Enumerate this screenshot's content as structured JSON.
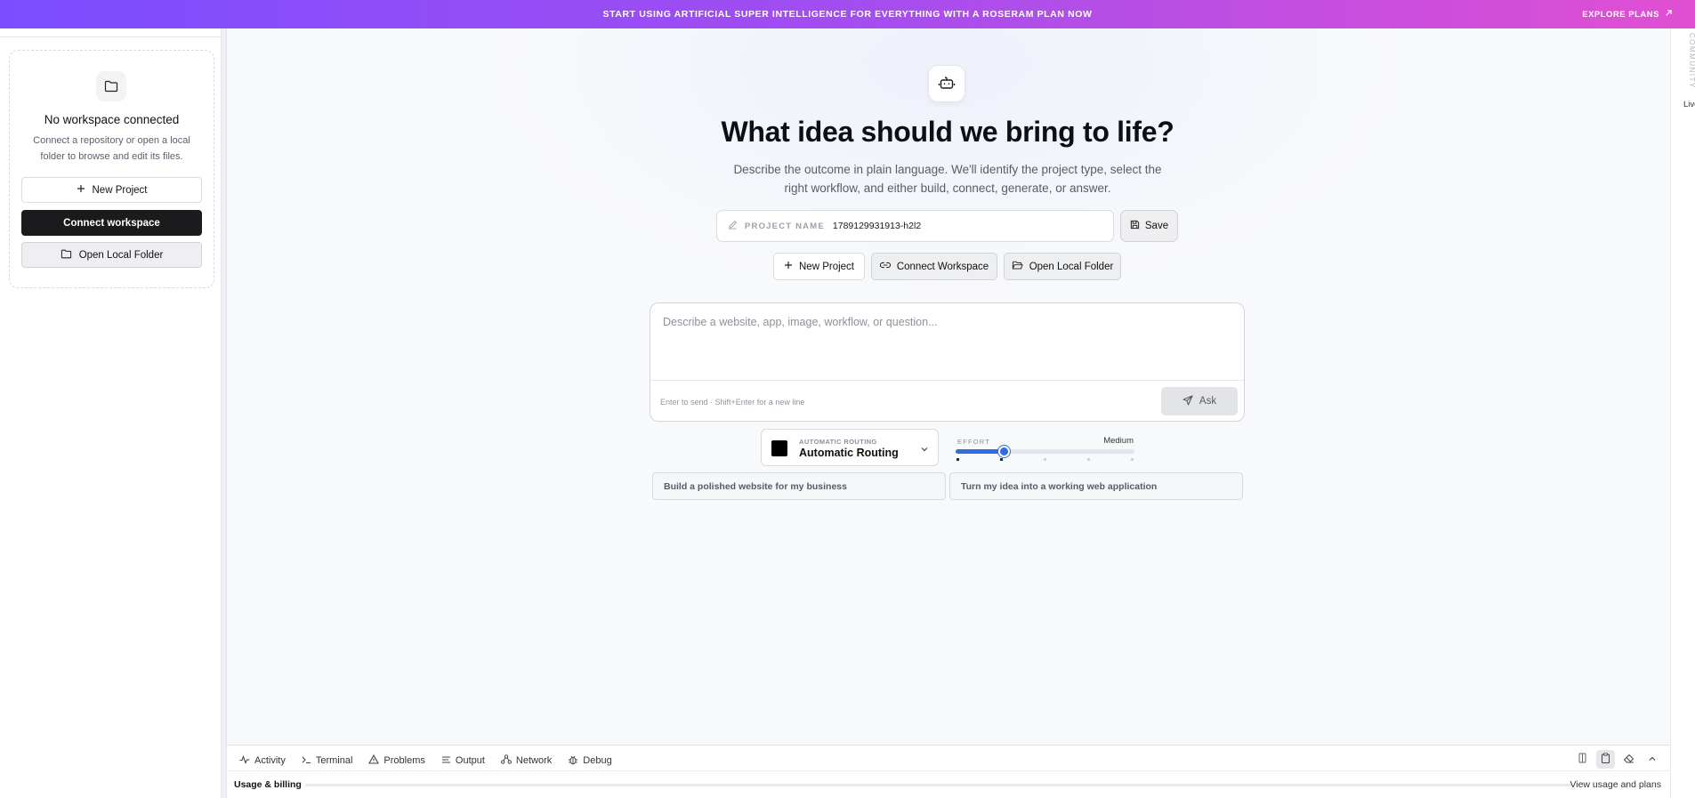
{
  "banner": {
    "message": "START USING ARTIFICIAL SUPER INTELLIGENCE FOR EVERYTHING WITH A ROSERAM PLAN NOW",
    "cta": "EXPLORE PLANS"
  },
  "sidebar": {
    "title": "No workspace connected",
    "description": "Connect a repository or open a local folder to browse and edit its files.",
    "new_project": "New Project",
    "connect_workspace": "Connect workspace",
    "open_local_folder": "Open Local Folder"
  },
  "main": {
    "title": "What idea should we bring to life?",
    "subtitle": "Describe the outcome in plain language. We'll identify the project type, select the right workflow, and either build, connect, generate, or answer.",
    "project_name_label": "PROJECT NAME",
    "project_name_value": "1789129931913-h2l2",
    "save": "Save",
    "actions": {
      "new_project": "New Project",
      "connect_workspace": "Connect Workspace",
      "open_local_folder": "Open Local Folder"
    },
    "prompt_placeholder": "Describe a website, app, image, workflow, or question...",
    "prompt_hint": "Enter to send · Shift+Enter for a new line",
    "ask": "Ask",
    "routing": {
      "caption": "AUTOMATIC ROUTING",
      "value": "Automatic Routing"
    },
    "effort": {
      "label": "EFFORT",
      "value": "Medium",
      "level": 0.27
    },
    "suggestions": [
      "Build a polished website for my business",
      "Turn my idea into a working web application"
    ]
  },
  "rail": {
    "community": "COMMUNITY",
    "live": "Live"
  },
  "bottom": {
    "tabs": [
      "Activity",
      "Terminal",
      "Problems",
      "Output",
      "Network",
      "Debug"
    ],
    "usage_label": "Usage & billing",
    "usage_link": "View usage and plans"
  },
  "colors": {
    "accent": "#2f6be3",
    "banner_start": "#7c4dff",
    "banner_end": "#e04fd2",
    "dark_button": "#1b1b1d"
  }
}
